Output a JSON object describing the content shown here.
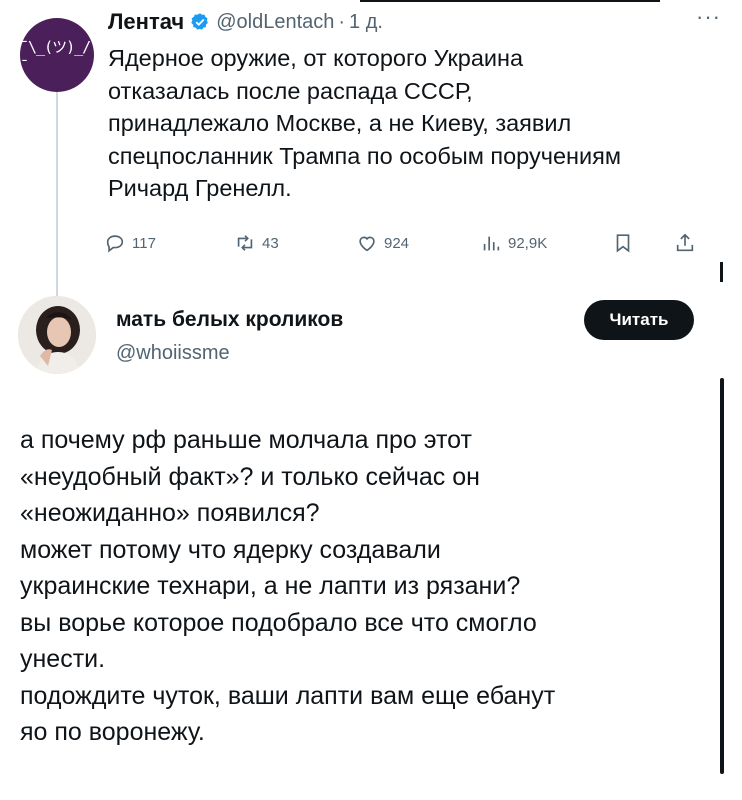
{
  "quoted_tweet": {
    "avatar_text": "¯\\_(ツ)_/¯",
    "author_name": "Лентач",
    "handle": "@oldLentach",
    "separator": "·",
    "time": "1 д.",
    "text_lines": [
      "Ядерное оружие, от которого Украина",
      "отказалась после распада СССР,",
      "принадлежало Москве, а не Киеву, заявил",
      "спецпосланник Трампа по особым поручениям",
      "Ричард Гренелл."
    ],
    "actions": {
      "replies": "117",
      "reposts": "43",
      "likes": "924",
      "views": "92,9K"
    }
  },
  "reply_tweet": {
    "author_name": "мать белых кроликов",
    "handle": "@whoiissme",
    "follow_label": "Читать",
    "text_lines": [
      "а почему рф раньше молчала про этот",
      "«неудобный факт»? и только сейчас он",
      "«неожиданно» появился?",
      "может потому что ядерку создавали",
      "украинские технари, а не лапти из рязани?",
      "вы ворье которое подобрало все что смогло",
      "унести.",
      "подождите чуток, ваши лапти вам еще ебанут",
      "яо по воронежу."
    ]
  },
  "colors": {
    "text": "#0f1419",
    "secondary": "#536471",
    "verified_blue": "#1d9bf0",
    "avatar_purple": "#4a1f5a"
  },
  "icons": [
    "verified-badge-icon",
    "more-icon",
    "reply-icon",
    "repost-icon",
    "like-icon",
    "views-icon",
    "bookmark-icon",
    "share-icon"
  ]
}
